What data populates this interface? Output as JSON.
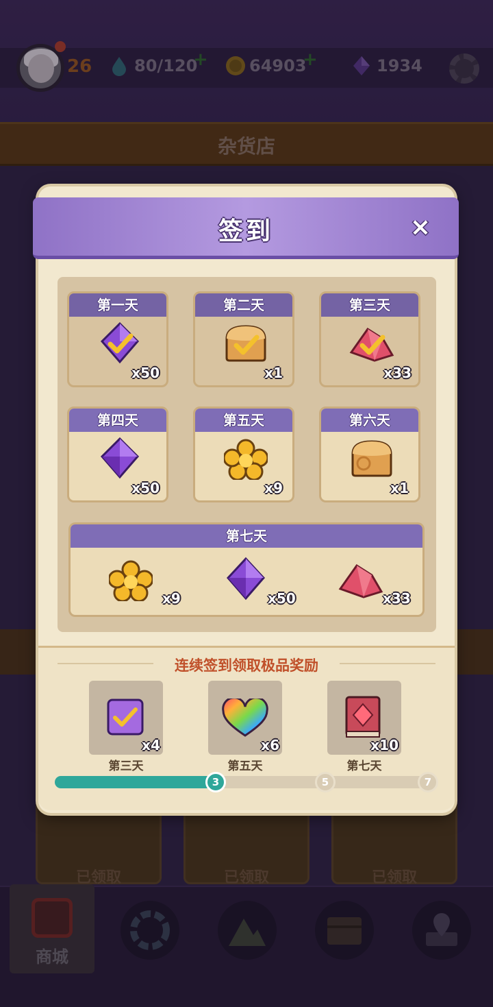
{
  "hud": {
    "level": "26",
    "stamina": "80/120",
    "coins": "64903",
    "gems": "1934",
    "icons": [
      "avatar",
      "water-drop-icon",
      "coin-icon",
      "gem-icon",
      "gear-icon"
    ]
  },
  "shop": {
    "title": "杂货店",
    "card_labels": [
      "已领取",
      "已领取",
      "已领取"
    ]
  },
  "nav": {
    "active_label": "商城",
    "icons": [
      "shop-icon",
      "portal-icon",
      "mountain-icon",
      "chest-icon",
      "map-pin-icon"
    ]
  },
  "dialog": {
    "title": "签到",
    "close": "×",
    "days": [
      {
        "label": "第一天",
        "qty": "x50",
        "item": "purple-gem",
        "claimed": true
      },
      {
        "label": "第二天",
        "qty": "x1",
        "item": "bread",
        "claimed": true
      },
      {
        "label": "第三天",
        "qty": "x33",
        "item": "red-crystal",
        "claimed": true
      },
      {
        "label": "第四天",
        "qty": "x50",
        "item": "purple-gem",
        "claimed": false
      },
      {
        "label": "第五天",
        "qty": "x9",
        "item": "gold-flower",
        "claimed": false
      },
      {
        "label": "第六天",
        "qty": "x1",
        "item": "bread",
        "claimed": false
      }
    ],
    "day7": {
      "label": "第七天",
      "items": [
        {
          "item": "gold-flower",
          "qty": "x9"
        },
        {
          "item": "purple-gem",
          "qty": "x50"
        },
        {
          "item": "red-crystal",
          "qty": "x33"
        }
      ]
    },
    "streak": {
      "title": "连续签到领取极品奖励",
      "rewards": [
        {
          "label": "第三天",
          "qty": "x4",
          "item": "purple-card"
        },
        {
          "label": "第五天",
          "qty": "x6",
          "item": "rainbow-heart"
        },
        {
          "label": "第七天",
          "qty": "x10",
          "item": "red-book"
        }
      ],
      "progress_days": 3,
      "max_days": 7,
      "markers": [
        "3",
        "5",
        "7"
      ]
    }
  },
  "colors": {
    "accent_purple": "#7f6db6",
    "progress_teal": "#2fa79a",
    "streak_title": "#c0502a"
  }
}
